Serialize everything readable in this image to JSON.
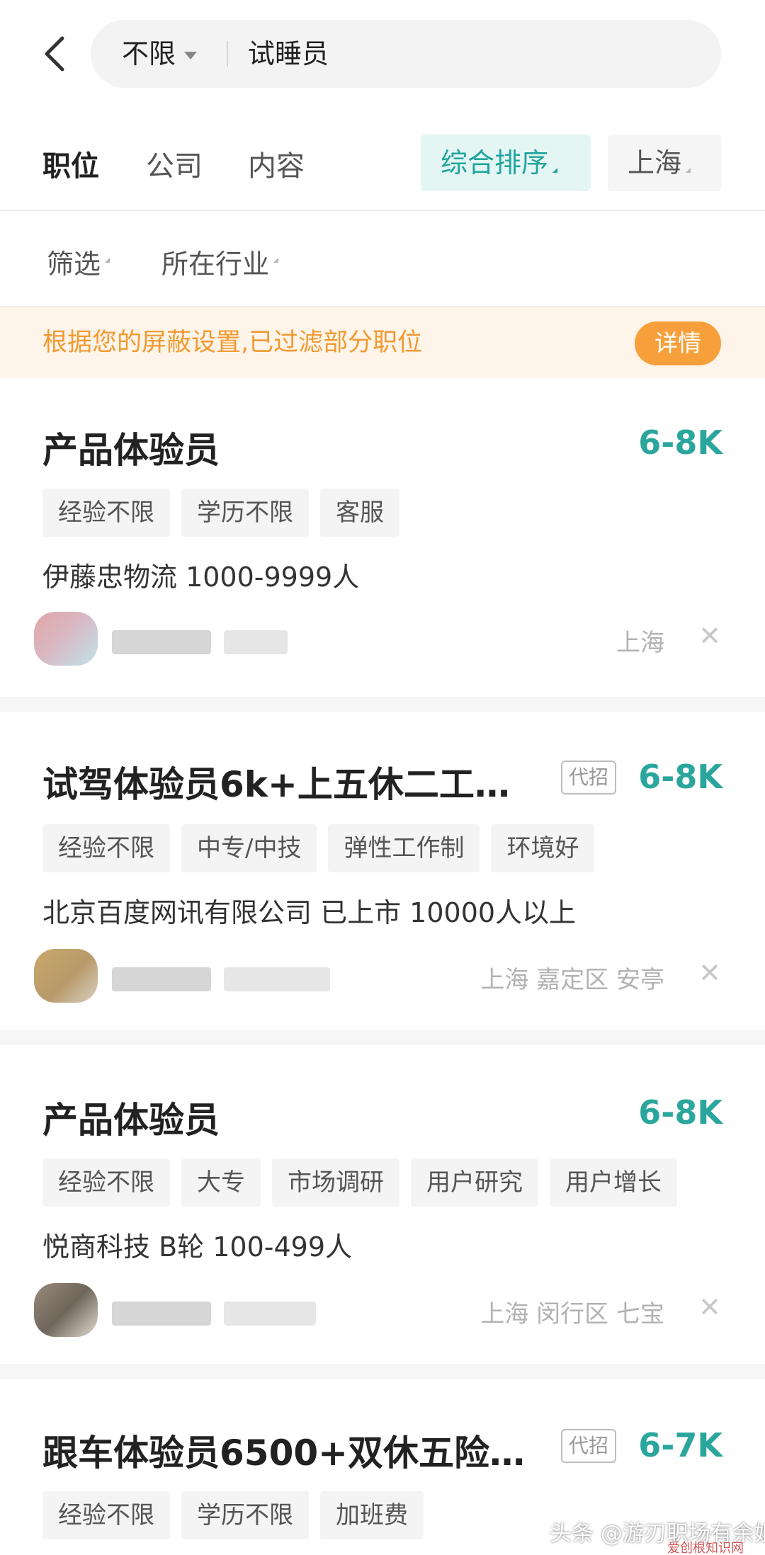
{
  "search": {
    "city_filter": "不限",
    "query": "试睡员"
  },
  "tabs": [
    "职位",
    "公司",
    "内容"
  ],
  "sort_label": "综合排序",
  "city_label": "上海",
  "filters": [
    "筛选",
    "所在行业"
  ],
  "notice": {
    "text": "根据您的屏蔽设置,已过滤部分职位",
    "button": "详情"
  },
  "jobs": [
    {
      "title": "产品体验员",
      "salary": "6-8K",
      "tags": [
        "经验不限",
        "学历不限",
        "客服"
      ],
      "company": "伊藤忠物流   1000-9999人",
      "location": "上海"
    },
    {
      "title": "试驾体验员6k+上五休二工…",
      "badge": "代招",
      "salary": "6-8K",
      "tags": [
        "经验不限",
        "中专/中技",
        "弹性工作制",
        "环境好"
      ],
      "company": "北京百度网讯有限公司  已上市  10000人以上",
      "location": "上海  嘉定区  安亭"
    },
    {
      "title": "产品体验员",
      "salary": "6-8K",
      "tags": [
        "经验不限",
        "大专",
        "市场调研",
        "用户研究",
        "用户增长"
      ],
      "company": "悦商科技  B轮  100-499人",
      "location": "上海  闵行区  七宝"
    },
    {
      "title": "跟车体验员6500+双休五险…",
      "badge": "代招",
      "salary": "6-7K",
      "tags": [
        "经验不限",
        "学历不限",
        "加班费"
      ]
    }
  ],
  "watermark": {
    "text": "头条 @游刃职场有余姐",
    "sub": "爱创根知识网"
  },
  "colors": {
    "accent": "#2aa69d",
    "notice_bg": "#fef4e9",
    "notice_text": "#f29a32",
    "notice_button": "#f7a03b"
  }
}
